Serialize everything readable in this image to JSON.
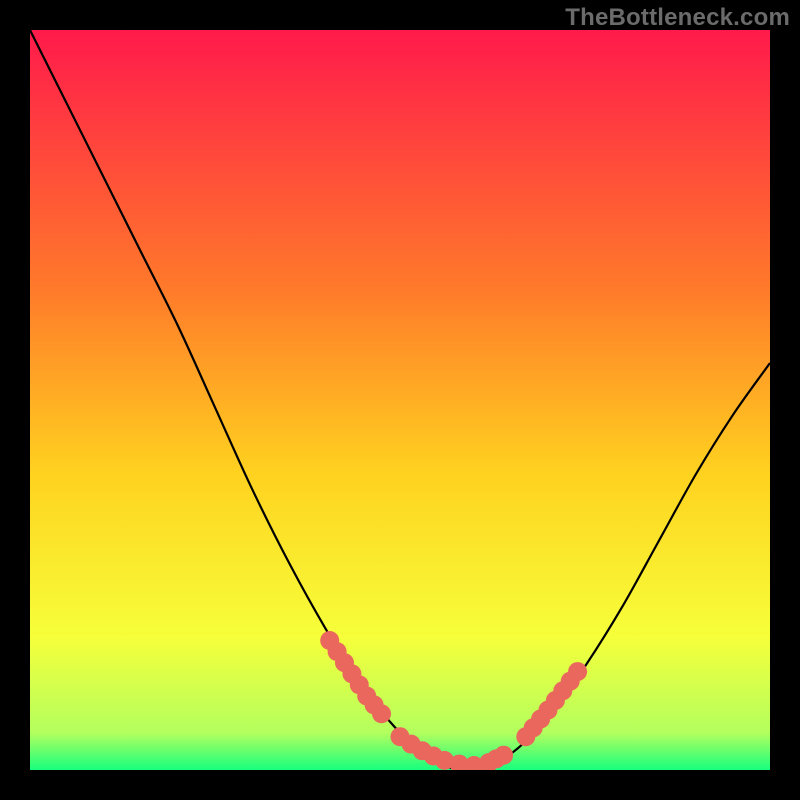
{
  "watermark": "TheBottleneck.com",
  "chart_data": {
    "type": "line",
    "title": "",
    "xlabel": "",
    "ylabel": "",
    "xlim": [
      0,
      100
    ],
    "ylim": [
      0,
      100
    ],
    "grid": false,
    "legend": false,
    "gradient_stops": [
      {
        "offset": 0,
        "color": "#ff1a4b"
      },
      {
        "offset": 35,
        "color": "#ff7a2a"
      },
      {
        "offset": 60,
        "color": "#ffd21f"
      },
      {
        "offset": 82,
        "color": "#f6ff3a"
      },
      {
        "offset": 95,
        "color": "#b3ff5e"
      },
      {
        "offset": 100,
        "color": "#17ff7e"
      }
    ],
    "series": [
      {
        "name": "bottleneck-curve",
        "color": "#000000",
        "x": [
          0,
          5,
          10,
          15,
          20,
          25,
          30,
          35,
          40,
          45,
          50,
          52,
          55,
          58,
          60,
          63,
          66,
          70,
          75,
          80,
          85,
          90,
          95,
          100
        ],
        "y": [
          100,
          90,
          80,
          70,
          60,
          49,
          38,
          28,
          19,
          11,
          5,
          3,
          1,
          0,
          0,
          1,
          3,
          7,
          14,
          22,
          31,
          40,
          48,
          55
        ]
      }
    ],
    "marker_clusters": [
      {
        "name": "left-cluster",
        "color": "#e9675d",
        "points": [
          {
            "x": 40.5,
            "y": 17.5
          },
          {
            "x": 41.5,
            "y": 16.0
          },
          {
            "x": 42.5,
            "y": 14.5
          },
          {
            "x": 43.5,
            "y": 13.0
          },
          {
            "x": 44.5,
            "y": 11.5
          },
          {
            "x": 45.5,
            "y": 10.0
          },
          {
            "x": 46.5,
            "y": 8.8
          },
          {
            "x": 47.5,
            "y": 7.6
          }
        ]
      },
      {
        "name": "bottom-cluster",
        "color": "#e9675d",
        "points": [
          {
            "x": 50.0,
            "y": 4.5
          },
          {
            "x": 51.5,
            "y": 3.5
          },
          {
            "x": 53.0,
            "y": 2.6
          },
          {
            "x": 54.5,
            "y": 1.9
          },
          {
            "x": 56.0,
            "y": 1.3
          },
          {
            "x": 58.0,
            "y": 0.8
          },
          {
            "x": 60.0,
            "y": 0.6
          },
          {
            "x": 62.0,
            "y": 1.0
          },
          {
            "x": 63.0,
            "y": 1.5
          },
          {
            "x": 64.0,
            "y": 2.0
          }
        ]
      },
      {
        "name": "right-cluster",
        "color": "#e9675d",
        "points": [
          {
            "x": 67.0,
            "y": 4.5
          },
          {
            "x": 68.0,
            "y": 5.7
          },
          {
            "x": 69.0,
            "y": 6.9
          },
          {
            "x": 70.0,
            "y": 8.1
          },
          {
            "x": 71.0,
            "y": 9.4
          },
          {
            "x": 72.0,
            "y": 10.7
          },
          {
            "x": 73.0,
            "y": 12.0
          },
          {
            "x": 74.0,
            "y": 13.3
          }
        ]
      }
    ]
  }
}
